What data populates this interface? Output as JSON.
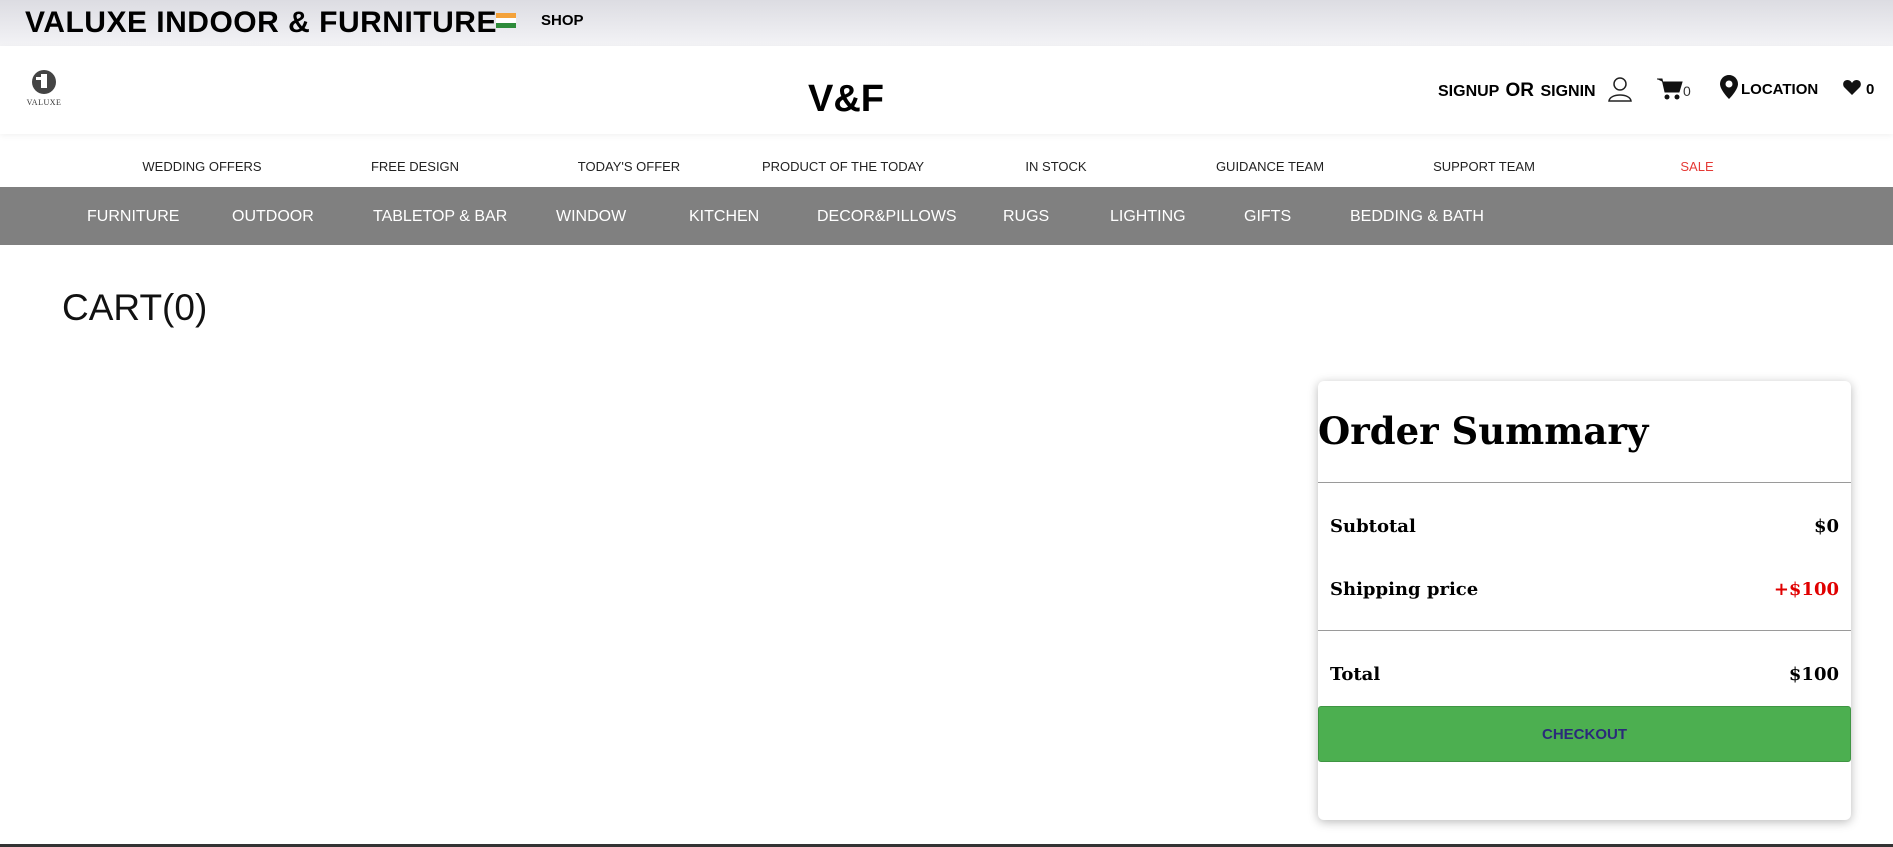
{
  "topbar": {
    "brand": "VALUXE INDOOR & FURNITURE",
    "flag_icon": "india-flag-icon",
    "shop_label": "SHOP"
  },
  "header": {
    "logo_text": "VALUXE",
    "center_logo": "V&F",
    "signup_label": "SIGNUP",
    "or_label": "OR",
    "signin_label": "SIGNIN",
    "user_icon": "user-icon",
    "cart_icon": "cart-icon",
    "cart_count": "0",
    "location_icon": "map-pin-icon",
    "location_label": "LOCATION",
    "wishlist_icon": "heart-icon",
    "wishlist_count": "0"
  },
  "promo_nav": [
    {
      "label": "WEDDING OFFERS"
    },
    {
      "label": "FREE DESIGN"
    },
    {
      "label": "TODAY'S OFFER"
    },
    {
      "label": "PRODUCT OF THE TODAY"
    },
    {
      "label": "IN STOCK"
    },
    {
      "label": "GUIDANCE TEAM"
    },
    {
      "label": "SUPPORT TEAM"
    },
    {
      "label": "SALE"
    }
  ],
  "category_nav": [
    {
      "label": "FURNITURE"
    },
    {
      "label": "OUTDOOR"
    },
    {
      "label": "TABLETOP & BAR"
    },
    {
      "label": "WINDOW"
    },
    {
      "label": "KITCHEN"
    },
    {
      "label": "DECOR&PILLOWS"
    },
    {
      "label": "RUGS"
    },
    {
      "label": "LIGHTING"
    },
    {
      "label": "GIFTS"
    },
    {
      "label": "BEDDING & BATH"
    }
  ],
  "cart": {
    "title": "CART(0)"
  },
  "order_summary": {
    "title": "Order Summary",
    "subtotal_label": "Subtotal",
    "subtotal_value": "$0",
    "shipping_label": "Shipping price",
    "shipping_value": "+$100",
    "total_label": "Total",
    "total_value": "$100",
    "checkout_label": "CHECKOUT"
  },
  "colors": {
    "sale": "#e53935",
    "shipping": "#e00000",
    "category_bar": "#808080",
    "checkout": "#4caf50",
    "checkout_text": "#2b2a7a"
  }
}
